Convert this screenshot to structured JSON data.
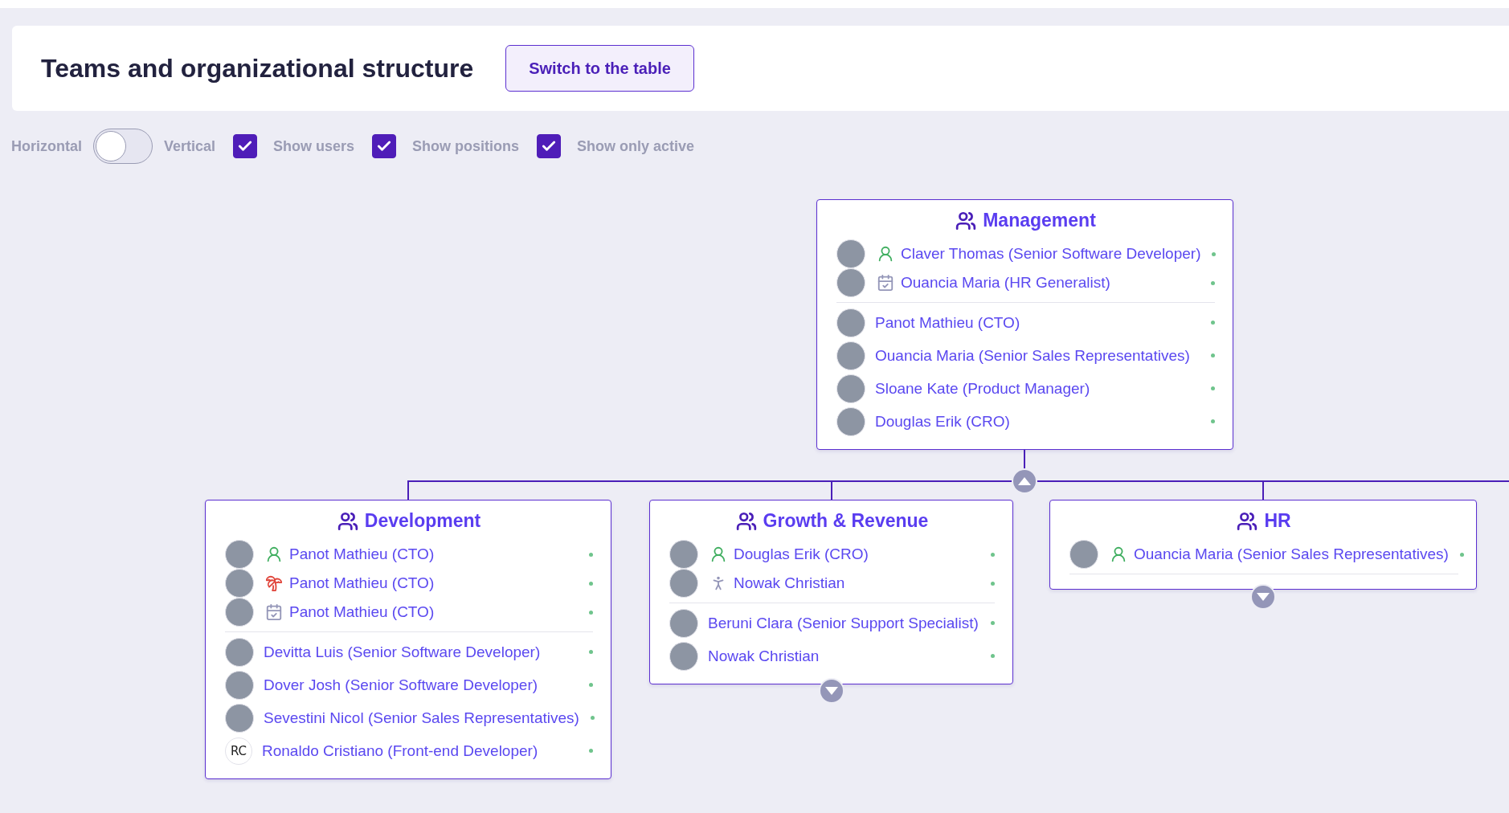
{
  "header": {
    "title": "Teams and organizational structure",
    "switch_button": "Switch to the table"
  },
  "controls": {
    "orientation": {
      "left_label": "Horizontal",
      "right_label": "Vertical",
      "on": false
    },
    "checkboxes": [
      {
        "label": "Show users",
        "checked": true
      },
      {
        "label": "Show positions",
        "checked": true
      },
      {
        "label": "Show only active",
        "checked": true
      }
    ]
  },
  "teams": [
    {
      "name": "Management",
      "expanded": true,
      "members": [
        {
          "kind": "photo",
          "status": {
            "kind": "lead"
          },
          "name": "Claver Thomas (Senior Software Developer)",
          "active": true
        },
        {
          "kind": "photo",
          "status": {
            "kind": "calendar"
          },
          "name": "Ouancia Maria (HR Generalist)",
          "active": true
        }
      ],
      "positions": [
        {
          "kind": "photo",
          "name": "Panot Mathieu (CTO)",
          "active": true
        },
        {
          "kind": "photo",
          "name": "Ouancia Maria (Senior Sales Representatives)",
          "active": true
        },
        {
          "kind": "photo",
          "name": "Sloane Kate (Product Manager)",
          "active": true
        },
        {
          "kind": "photo",
          "name": "Douglas Erik (CRO)",
          "active": true
        }
      ],
      "children": [
        {
          "name": "Development",
          "members": [
            {
              "kind": "photo",
              "status": {
                "kind": "lead"
              },
              "name": "Panot Mathieu (CTO)",
              "active": true
            },
            {
              "kind": "photo",
              "status": {
                "kind": "vacation"
              },
              "name": "Panot Mathieu (CTO)",
              "active": true
            },
            {
              "kind": "photo",
              "status": {
                "kind": "calendar"
              },
              "name": "Panot Mathieu (CTO)",
              "active": true
            }
          ],
          "positions": [
            {
              "kind": "photo",
              "name": "Devitta Luis (Senior Software Developer)",
              "active": true
            },
            {
              "kind": "photo",
              "name": "Dover Josh (Senior Software Developer)",
              "active": true
            },
            {
              "kind": "photo",
              "name": "Sevestini Nicol (Senior Sales Representatives)",
              "active": true
            },
            {
              "kind": "initials",
              "initials": "RC",
              "name": "Ronaldo Cristiano (Front-end Developer)",
              "active": true
            }
          ]
        },
        {
          "name": "Growth & Revenue",
          "expanded": false,
          "members": [
            {
              "kind": "photo",
              "status": {
                "kind": "lead"
              },
              "name": "Douglas Erik (CRO)",
              "active": true
            },
            {
              "kind": "photo",
              "status": {
                "kind": "walking"
              },
              "name": "Nowak Christian",
              "active": true
            }
          ],
          "positions": [
            {
              "kind": "photo",
              "name": "Beruni Clara (Senior Support Specialist)",
              "active": true
            },
            {
              "kind": "photo",
              "name": "Nowak Christian",
              "active": true
            }
          ]
        },
        {
          "name": "HR",
          "expanded": false,
          "members": [
            {
              "kind": "photo",
              "status": {
                "kind": "lead"
              },
              "name": "Ouancia Maria (Senior Sales Representatives)",
              "active": true
            }
          ]
        }
      ]
    }
  ]
}
